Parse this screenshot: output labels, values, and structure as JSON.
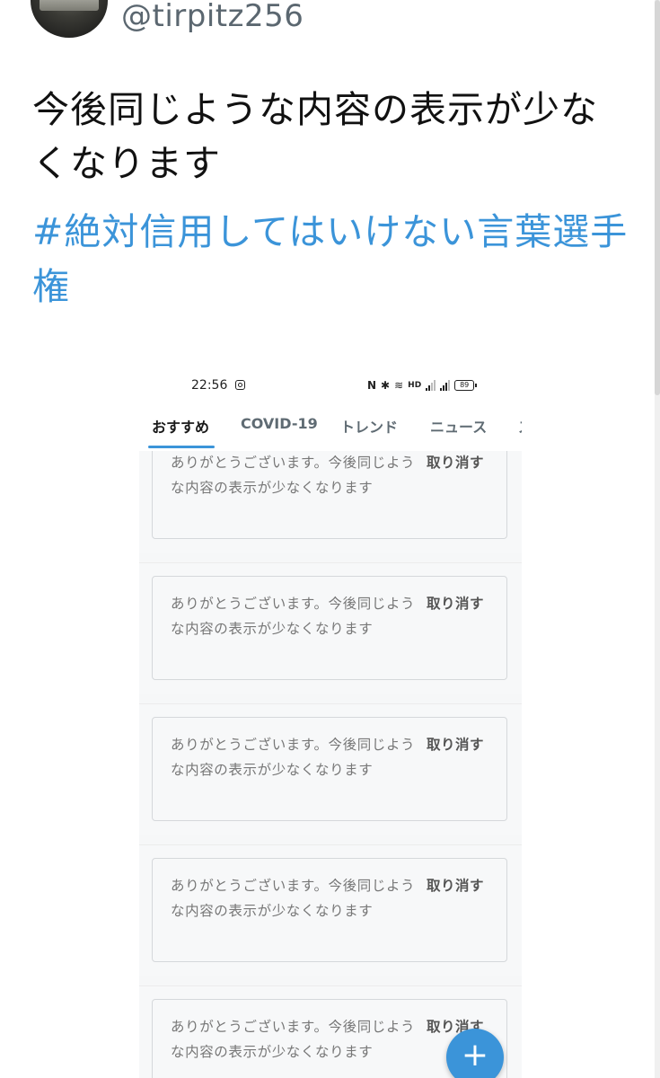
{
  "tweet": {
    "username": "@tirpitz256",
    "text": "今後同じような内容の表示が少なくなります",
    "hashtag": "#絶対信用してはいけない言葉選手権"
  },
  "phone": {
    "status_bar": {
      "time": "22:56",
      "battery": "89"
    },
    "tabs": [
      {
        "label": "おすすめ",
        "active": true
      },
      {
        "label": "COVID-19",
        "active": false
      },
      {
        "label": "トレンド",
        "active": false
      },
      {
        "label": "ニュース",
        "active": false
      },
      {
        "label": "ス",
        "active": false
      }
    ],
    "feed": [
      {
        "message": "ありがとうございます。今後同じような内容の表示が少なくなります",
        "undo_label": "取り消す"
      },
      {
        "message": "ありがとうございます。今後同じような内容の表示が少なくなります",
        "undo_label": "取り消す"
      },
      {
        "message": "ありがとうございます。今後同じような内容の表示が少なくなります",
        "undo_label": "取り消す"
      },
      {
        "message": "ありがとうございます。今後同じような内容の表示が少なくなります",
        "undo_label": "取り消す"
      },
      {
        "message": "ありがとうございます。今後同じような内容の表示が少なくなります",
        "undo_label": "取り消す"
      }
    ],
    "fab_label": "+"
  },
  "colors": {
    "accent": "#3b94d9",
    "username": "#5b6770",
    "text": "#111111"
  }
}
